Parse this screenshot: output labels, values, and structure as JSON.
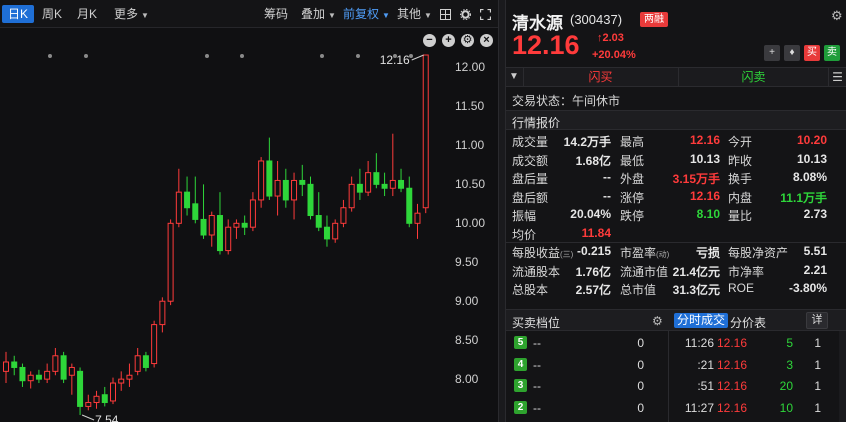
{
  "toolbar": {
    "period_tabs": [
      "日K",
      "周K",
      "月K"
    ],
    "more": "更多",
    "indicators": "筹码",
    "overlay": "叠加",
    "adjust": "前复权",
    "other": "其他"
  },
  "chart": {
    "y_ticks": [
      "12.00",
      "11.50",
      "11.00",
      "10.50",
      "10.00",
      "9.50",
      "9.00",
      "8.50",
      "8.00"
    ],
    "high_marker": "12.16",
    "low_marker": "7.54",
    "colors": {
      "up": "#ff3b3b",
      "down": "#2ed63a",
      "bg": "#101012"
    }
  },
  "chart_data": {
    "type": "candlestick",
    "ylim": [
      7.45,
      12.25
    ],
    "y_ticks": [
      12.0,
      11.5,
      11.0,
      10.5,
      10.0,
      9.5,
      9.0,
      8.5,
      8.0
    ],
    "candles": [
      {
        "o": 8.1,
        "h": 8.35,
        "l": 7.95,
        "c": 8.22
      },
      {
        "o": 8.22,
        "h": 8.3,
        "l": 8.05,
        "c": 8.15
      },
      {
        "o": 8.15,
        "h": 8.2,
        "l": 7.9,
        "c": 7.98
      },
      {
        "o": 7.98,
        "h": 8.1,
        "l": 7.88,
        "c": 8.05
      },
      {
        "o": 8.05,
        "h": 8.12,
        "l": 7.95,
        "c": 8.0
      },
      {
        "o": 8.0,
        "h": 8.2,
        "l": 7.95,
        "c": 8.1
      },
      {
        "o": 8.1,
        "h": 8.4,
        "l": 8.05,
        "c": 8.3
      },
      {
        "o": 8.3,
        "h": 8.35,
        "l": 7.95,
        "c": 8.0
      },
      {
        "o": 8.05,
        "h": 8.2,
        "l": 7.8,
        "c": 8.15
      },
      {
        "o": 8.1,
        "h": 8.15,
        "l": 7.54,
        "c": 7.65
      },
      {
        "o": 7.65,
        "h": 7.8,
        "l": 7.6,
        "c": 7.7
      },
      {
        "o": 7.7,
        "h": 7.85,
        "l": 7.62,
        "c": 7.78
      },
      {
        "o": 7.8,
        "h": 7.9,
        "l": 7.65,
        "c": 7.7
      },
      {
        "o": 7.72,
        "h": 8.02,
        "l": 7.68,
        "c": 7.95
      },
      {
        "o": 7.95,
        "h": 8.1,
        "l": 7.85,
        "c": 8.0
      },
      {
        "o": 8.0,
        "h": 8.2,
        "l": 7.9,
        "c": 8.05
      },
      {
        "o": 8.1,
        "h": 8.4,
        "l": 8.05,
        "c": 8.3
      },
      {
        "o": 8.3,
        "h": 8.35,
        "l": 8.1,
        "c": 8.15
      },
      {
        "o": 8.2,
        "h": 8.75,
        "l": 8.15,
        "c": 8.7
      },
      {
        "o": 8.7,
        "h": 9.05,
        "l": 8.6,
        "c": 9.0
      },
      {
        "o": 9.0,
        "h": 10.05,
        "l": 8.95,
        "c": 10.0
      },
      {
        "o": 10.0,
        "h": 10.7,
        "l": 9.95,
        "c": 10.4
      },
      {
        "o": 10.4,
        "h": 10.6,
        "l": 10.1,
        "c": 10.2
      },
      {
        "o": 10.25,
        "h": 10.6,
        "l": 10.0,
        "c": 10.05
      },
      {
        "o": 10.05,
        "h": 10.5,
        "l": 9.8,
        "c": 9.85
      },
      {
        "o": 9.85,
        "h": 10.15,
        "l": 9.7,
        "c": 10.1
      },
      {
        "o": 10.1,
        "h": 10.4,
        "l": 9.6,
        "c": 9.65
      },
      {
        "o": 9.65,
        "h": 10.05,
        "l": 9.6,
        "c": 9.95
      },
      {
        "o": 9.95,
        "h": 10.05,
        "l": 9.8,
        "c": 10.0
      },
      {
        "o": 10.0,
        "h": 10.1,
        "l": 9.85,
        "c": 9.95
      },
      {
        "o": 9.95,
        "h": 10.4,
        "l": 9.9,
        "c": 10.3
      },
      {
        "o": 10.3,
        "h": 10.85,
        "l": 10.2,
        "c": 10.8
      },
      {
        "o": 10.8,
        "h": 11.1,
        "l": 10.3,
        "c": 10.35
      },
      {
        "o": 10.35,
        "h": 10.8,
        "l": 10.1,
        "c": 10.55
      },
      {
        "o": 10.55,
        "h": 10.7,
        "l": 10.2,
        "c": 10.3
      },
      {
        "o": 10.3,
        "h": 10.65,
        "l": 10.05,
        "c": 10.55
      },
      {
        "o": 10.55,
        "h": 10.75,
        "l": 10.35,
        "c": 10.5
      },
      {
        "o": 10.5,
        "h": 10.6,
        "l": 10.05,
        "c": 10.1
      },
      {
        "o": 10.1,
        "h": 10.4,
        "l": 9.9,
        "c": 9.95
      },
      {
        "o": 9.95,
        "h": 10.1,
        "l": 9.7,
        "c": 9.8
      },
      {
        "o": 9.8,
        "h": 10.05,
        "l": 9.75,
        "c": 10.0
      },
      {
        "o": 10.0,
        "h": 10.3,
        "l": 9.95,
        "c": 10.2
      },
      {
        "o": 10.2,
        "h": 10.6,
        "l": 10.15,
        "c": 10.5
      },
      {
        "o": 10.5,
        "h": 10.7,
        "l": 10.3,
        "c": 10.4
      },
      {
        "o": 10.4,
        "h": 10.8,
        "l": 10.35,
        "c": 10.65
      },
      {
        "o": 10.65,
        "h": 10.9,
        "l": 10.45,
        "c": 10.5
      },
      {
        "o": 10.5,
        "h": 10.65,
        "l": 10.35,
        "c": 10.45
      },
      {
        "o": 10.45,
        "h": 11.15,
        "l": 10.35,
        "c": 10.55
      },
      {
        "o": 10.55,
        "h": 10.7,
        "l": 10.4,
        "c": 10.45
      },
      {
        "o": 10.45,
        "h": 10.6,
        "l": 9.95,
        "c": 10.0
      },
      {
        "o": 10.0,
        "h": 10.25,
        "l": 9.8,
        "c": 10.13
      },
      {
        "o": 10.2,
        "h": 12.16,
        "l": 10.13,
        "c": 12.16
      }
    ]
  },
  "quote": {
    "name": "清水源",
    "code": "(300437)",
    "badge": "两融",
    "price": "12.16",
    "change": "2.03",
    "change_pct": "+20.04%",
    "flash_buy": "闪买",
    "flash_sell": "闪卖",
    "buy_btn": "买",
    "sell_btn": "卖",
    "status_label": "交易状态：",
    "status_value": "午间休市",
    "section_quotes": "行情报价",
    "rows": [
      [
        {
          "l": "成交量",
          "v": "14.2万手",
          "c": ""
        },
        {
          "l": "最高",
          "v": "12.16",
          "c": "red"
        },
        {
          "l": "今开",
          "v": "10.20",
          "c": "red"
        }
      ],
      [
        {
          "l": "成交额",
          "v": "1.68亿",
          "c": ""
        },
        {
          "l": "最低",
          "v": "10.13",
          "c": ""
        },
        {
          "l": "昨收",
          "v": "10.13",
          "c": ""
        }
      ],
      [
        {
          "l": "盘后量",
          "v": "--",
          "c": ""
        },
        {
          "l": "外盘",
          "v": "3.15万手",
          "c": "red"
        },
        {
          "l": "换手",
          "v": "8.08%",
          "c": ""
        }
      ],
      [
        {
          "l": "盘后额",
          "v": "--",
          "c": ""
        },
        {
          "l": "涨停",
          "v": "12.16",
          "c": "red"
        },
        {
          "l": "内盘",
          "v": "11.1万手",
          "c": "green"
        }
      ],
      [
        {
          "l": "振幅",
          "v": "20.04%",
          "c": ""
        },
        {
          "l": "跌停",
          "v": "8.10",
          "c": "green"
        },
        {
          "l": "量比",
          "v": "2.73",
          "c": ""
        }
      ],
      [
        {
          "l": "均价",
          "v": "11.84",
          "c": "red"
        }
      ]
    ],
    "rows2": [
      [
        {
          "l": "每股收益",
          "sub": "(三)",
          "v": "-0.215",
          "c": ""
        },
        {
          "l": "市盈率",
          "sub": "(动)",
          "v": "亏损",
          "c": ""
        },
        {
          "l": "每股净资产",
          "v": "5.51",
          "c": ""
        }
      ],
      [
        {
          "l": "流通股本",
          "v": "1.76亿",
          "c": ""
        },
        {
          "l": "流通市值",
          "v": "21.4亿元",
          "c": ""
        },
        {
          "l": "市净率",
          "v": "2.21",
          "c": ""
        }
      ],
      [
        {
          "l": "总股本",
          "v": "2.57亿",
          "c": ""
        },
        {
          "l": "总市值",
          "v": "31.3亿元",
          "c": ""
        },
        {
          "l": "ROE",
          "v": "-3.80%",
          "c": ""
        }
      ]
    ],
    "orderbook_title": "买卖档位",
    "tab_ticks": "分时成交",
    "tab_price": "分价表",
    "detail": "详",
    "orderbook": [
      {
        "lvl": "5",
        "price": "--",
        "vol": "0"
      },
      {
        "lvl": "4",
        "price": "--",
        "vol": "0"
      },
      {
        "lvl": "3",
        "price": "--",
        "vol": "0"
      },
      {
        "lvl": "2",
        "price": "--",
        "vol": "0"
      }
    ],
    "ticks": [
      {
        "t": "11:26",
        "p": "12.16",
        "v": "5",
        "n": "1"
      },
      {
        "t": ":21",
        "p": "12.16",
        "v": "3",
        "n": "1"
      },
      {
        "t": ":51",
        "p": "12.16",
        "v": "20",
        "n": "1"
      },
      {
        "t": "11:27",
        "p": "12.16",
        "v": "10",
        "n": "1"
      }
    ]
  }
}
